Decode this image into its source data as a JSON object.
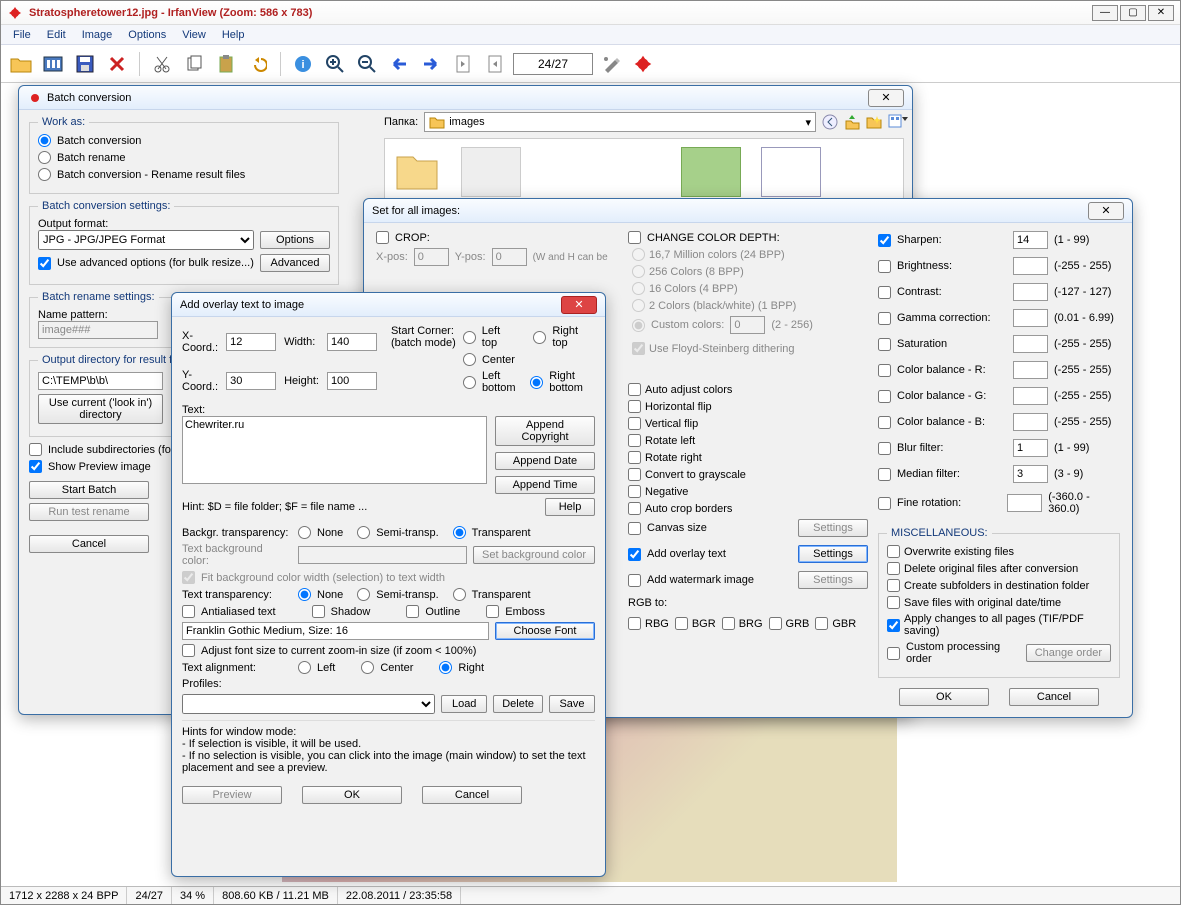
{
  "main": {
    "title": "Stratospheretower12.jpg - IrfanView (Zoom: 586 x 783)",
    "menu": [
      "File",
      "Edit",
      "Image",
      "Options",
      "View",
      "Help"
    ],
    "counter": "24/27"
  },
  "status": {
    "dims": "1712 x 2288 x 24 BPP",
    "idx": "24/27",
    "zoom": "34 %",
    "size": "808.60 KB / 11.21 MB",
    "date": "22.08.2011 / 23:35:58"
  },
  "batch": {
    "title": "Batch conversion",
    "work_as": "Work as:",
    "opt1": "Batch conversion",
    "opt2": "Batch rename",
    "opt3": "Batch conversion - Rename result files",
    "settings_label": "Batch conversion settings:",
    "output_format_label": "Output format:",
    "output_format": "JPG - JPG/JPEG Format",
    "options_btn": "Options",
    "use_adv": "Use advanced options (for bulk resize...)",
    "adv_btn": "Advanced",
    "rename_label": "Batch rename settings:",
    "name_pattern_label": "Name pattern:",
    "name_pattern": "image###",
    "outdir_label": "Output directory for result files:",
    "outdir": "C:\\TEMP\\b\\b\\",
    "use_current": "Use current ('look in') directory",
    "include_sub": "Include subdirectories (for 'Add all'; not saved on exit)",
    "show_preview": "Show Preview image",
    "start": "Start Batch",
    "run_test": "Run test rename",
    "cancel": "Cancel",
    "folder_label": "Папка:",
    "folder_value": "images"
  },
  "overlay": {
    "title": "Add overlay text to image",
    "x_label": "X-Coord.:",
    "x": "12",
    "y_label": "Y-Coord.:",
    "y": "30",
    "w_label": "Width:",
    "w": "140",
    "h_label": "Height:",
    "h": "100",
    "start_corner": "Start Corner: (batch mode)",
    "lt": "Left top",
    "rt": "Right top",
    "c": "Center",
    "lb": "Left bottom",
    "rb": "Right bottom",
    "text_label": "Text:",
    "text": "Chewriter.ru",
    "append_c": "Append Copyright",
    "append_d": "Append Date",
    "append_t": "Append Time",
    "hint1": "Hint: $D = file folder; $F = file name ...",
    "help": "Help",
    "bg_trans": "Backgr. transparency:",
    "none": "None",
    "semi": "Semi-transp.",
    "trans": "Transparent",
    "bg_color": "Text background color:",
    "set_bg": "Set background color",
    "fit_bg": "Fit background color width (selection) to text width",
    "text_trans": "Text transparency:",
    "aa": "Antialiased text",
    "shadow": "Shadow",
    "outline": "Outline",
    "emboss": "Emboss",
    "font": "Franklin Gothic Medium, Size: 16",
    "choose_font": "Choose Font",
    "adjust_font": "Adjust font size to current zoom-in size (if zoom < 100%)",
    "align": "Text alignment:",
    "a_left": "Left",
    "a_center": "Center",
    "a_right": "Right",
    "profiles": "Profiles:",
    "load": "Load",
    "delete": "Delete",
    "save": "Save",
    "hints_hdr": "Hints for window mode:",
    "hints1": "- If selection is visible, it will be used.",
    "hints2": "- If no selection is visible, you can click into the image (main window) to set the text placement and see a preview.",
    "preview": "Preview",
    "ok": "OK",
    "cancel": "Cancel"
  },
  "setall": {
    "title": "Set for all images:",
    "crop": "CROP:",
    "xpos": "X-pos:",
    "xpos_v": "0",
    "ypos": "Y-pos:",
    "ypos_v": "0",
    "wh_note": "(W and H can be",
    "ccd": "CHANGE COLOR DEPTH:",
    "cd1": "16,7 Million colors (24 BPP)",
    "cd2": "256 Colors (8 BPP)",
    "cd3": "16 Colors (4 BPP)",
    "cd4": "2 Colors (black/white) (1 BPP)",
    "cd5": "Custom colors:",
    "cd5v": "0",
    "cd5r": "(2 - 256)",
    "fs": "Use Floyd-Steinberg dithering",
    "auto_adj": "Auto adjust colors",
    "hflip": "Horizontal flip",
    "vflip": "Vertical flip",
    "rleft": "Rotate left",
    "rright": "Rotate right",
    "gray": "Convert to grayscale",
    "neg": "Negative",
    "autocrop": "Auto crop borders",
    "canvas": "Canvas size",
    "add_ovl": "Add overlay text",
    "add_wm": "Add watermark image",
    "settings": "Settings",
    "rgb_to": "RGB to:",
    "rgb_opts": [
      "RBG",
      "BGR",
      "BRG",
      "GRB",
      "GBR"
    ],
    "sharpen": "Sharpen:",
    "sharpen_v": "14",
    "sharpen_r": "(1  -  99)",
    "bright": "Brightness:",
    "bright_r": "(-255  -  255)",
    "contrast": "Contrast:",
    "contrast_r": "(-127  -  127)",
    "gamma": "Gamma correction:",
    "gamma_r": "(0.01  -  6.99)",
    "sat": "Saturation",
    "sat_r": "(-255  -  255)",
    "cr": "Color balance - R:",
    "cr_r": "(-255  -  255)",
    "cg": "Color balance - G:",
    "cg_r": "(-255  -  255)",
    "cb": "Color balance - B:",
    "cb_r": "(-255  -  255)",
    "blur": "Blur filter:",
    "blur_v": "1",
    "blur_r": "(1  -  99)",
    "median": "Median filter:",
    "median_v": "3",
    "median_r": "(3  -  9)",
    "fine": "Fine rotation:",
    "fine_r": "(-360.0  -  360.0)",
    "misc": "MISCELLANEOUS:",
    "m1": "Overwrite existing files",
    "m2": "Delete original files after conversion",
    "m3": "Create subfolders in destination folder",
    "m4": "Save files with original date/time",
    "m5": "Apply changes to all pages (TIF/PDF saving)",
    "m6": "Custom processing order",
    "chg_order": "Change order",
    "ok": "OK",
    "cancel": "Cancel"
  }
}
